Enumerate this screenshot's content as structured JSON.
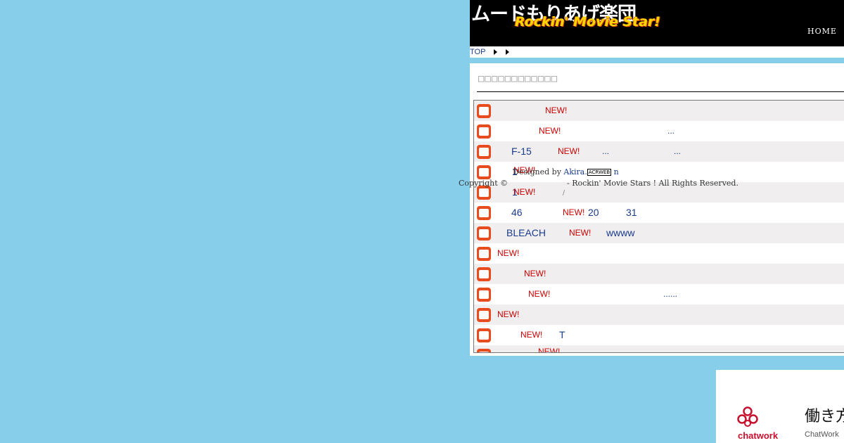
{
  "header": {
    "logo_jp": "ムードもりあげ楽団",
    "logo_en": "Rockin' Movie Star!",
    "nav_home": "HOME"
  },
  "breadcrumb": {
    "top": "TOP"
  },
  "panel": {
    "title": "□□□□□□□□□□□□",
    "rows": [
      {
        "icon": "cat-face-icon",
        "new": "NEW!"
      },
      {
        "icon": "news-icon",
        "new": "NEW!",
        "extra": "..."
      },
      {
        "icon": "news-icon",
        "pre": "F-15",
        "new": "NEW!",
        "extra": "...",
        "extra2": "..."
      },
      {
        "icon": "cat-face-icon",
        "pre": "1",
        "new": "NEW!"
      },
      {
        "icon": "cat-face-icon",
        "pre": "1",
        "new": "NEW!"
      },
      {
        "icon": "star-icon",
        "pre": "46",
        "new": "NEW!",
        "extra": "20",
        "extra2": "31"
      },
      {
        "icon": "star-icon",
        "pre": "BLEACH",
        "new": "NEW!",
        "extra": "wwww"
      },
      {
        "icon": "home-icon",
        "new": "NEW!"
      },
      {
        "icon": "game-icon",
        "new": "NEW!"
      },
      {
        "icon": "news-icon",
        "new": "NEW!",
        "extra": "......"
      },
      {
        "icon": "star-icon",
        "new": "NEW!"
      },
      {
        "icon": "news-icon",
        "new": "NEW!",
        "extra": "T"
      },
      {
        "icon": "news-icon",
        "new": "NEW!"
      }
    ]
  },
  "footer": {
    "designed_by": "Designed by",
    "designer": "Akira.",
    "acrweb": "ACRWEB",
    "designer_suffix": "n",
    "copyright": "Copyright ©",
    "rights": "- Rockin' Movie Stars ! All Rights Reserved.",
    "slash": "/"
  },
  "ad": {
    "brand": "chatwork",
    "headline": "働き方",
    "sub": "ChatWork"
  },
  "colors": {
    "page_bg": "#87ceeb",
    "accent_red": "#cc0000",
    "link_blue": "#1a3b8c",
    "icon_orange": "#e84c1e"
  }
}
